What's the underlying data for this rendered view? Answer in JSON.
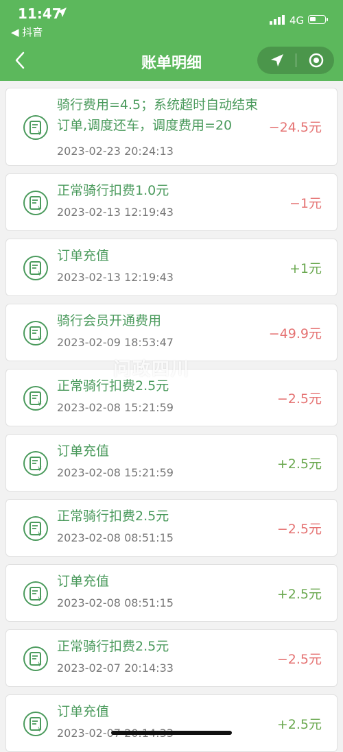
{
  "status": {
    "time": "11:47",
    "back_app": "◀ 抖音",
    "network": "4G"
  },
  "nav": {
    "title": "账单明细"
  },
  "watermark": "问政四川",
  "colors": {
    "header": "#5cb85c",
    "negative": "#e57373",
    "positive": "#6aa84f",
    "title": "#4a9a5c"
  },
  "items": [
    {
      "title_line1": "骑行费用=4.5；系统超时自动结束",
      "title_line2": "订单,调度还车，调度费用=20",
      "date": "2023-02-23 20:24:13",
      "amount": "−24.5元",
      "sign": "neg"
    },
    {
      "title_line1": "正常骑行扣费1.0元",
      "date": "2023-02-13 12:19:43",
      "amount": "−1元",
      "sign": "neg"
    },
    {
      "title_line1": "订单充值",
      "date": "2023-02-13 12:19:43",
      "amount": "+1元",
      "sign": "pos"
    },
    {
      "title_line1": "骑行会员开通费用",
      "date": "2023-02-09 18:53:47",
      "amount": "−49.9元",
      "sign": "neg"
    },
    {
      "title_line1": "正常骑行扣费2.5元",
      "date": "2023-02-08 15:21:59",
      "amount": "−2.5元",
      "sign": "neg"
    },
    {
      "title_line1": "订单充值",
      "date": "2023-02-08 15:21:59",
      "amount": "+2.5元",
      "sign": "pos"
    },
    {
      "title_line1": "正常骑行扣费2.5元",
      "date": "2023-02-08 08:51:15",
      "amount": "−2.5元",
      "sign": "neg"
    },
    {
      "title_line1": "订单充值",
      "date": "2023-02-08 08:51:15",
      "amount": "+2.5元",
      "sign": "pos"
    },
    {
      "title_line1": "正常骑行扣费2.5元",
      "date": "2023-02-07 20:14:33",
      "amount": "−2.5元",
      "sign": "neg"
    },
    {
      "title_line1": "订单充值",
      "date": "2023-02-07 20:14:33",
      "amount": "+2.5元",
      "sign": "pos"
    }
  ]
}
